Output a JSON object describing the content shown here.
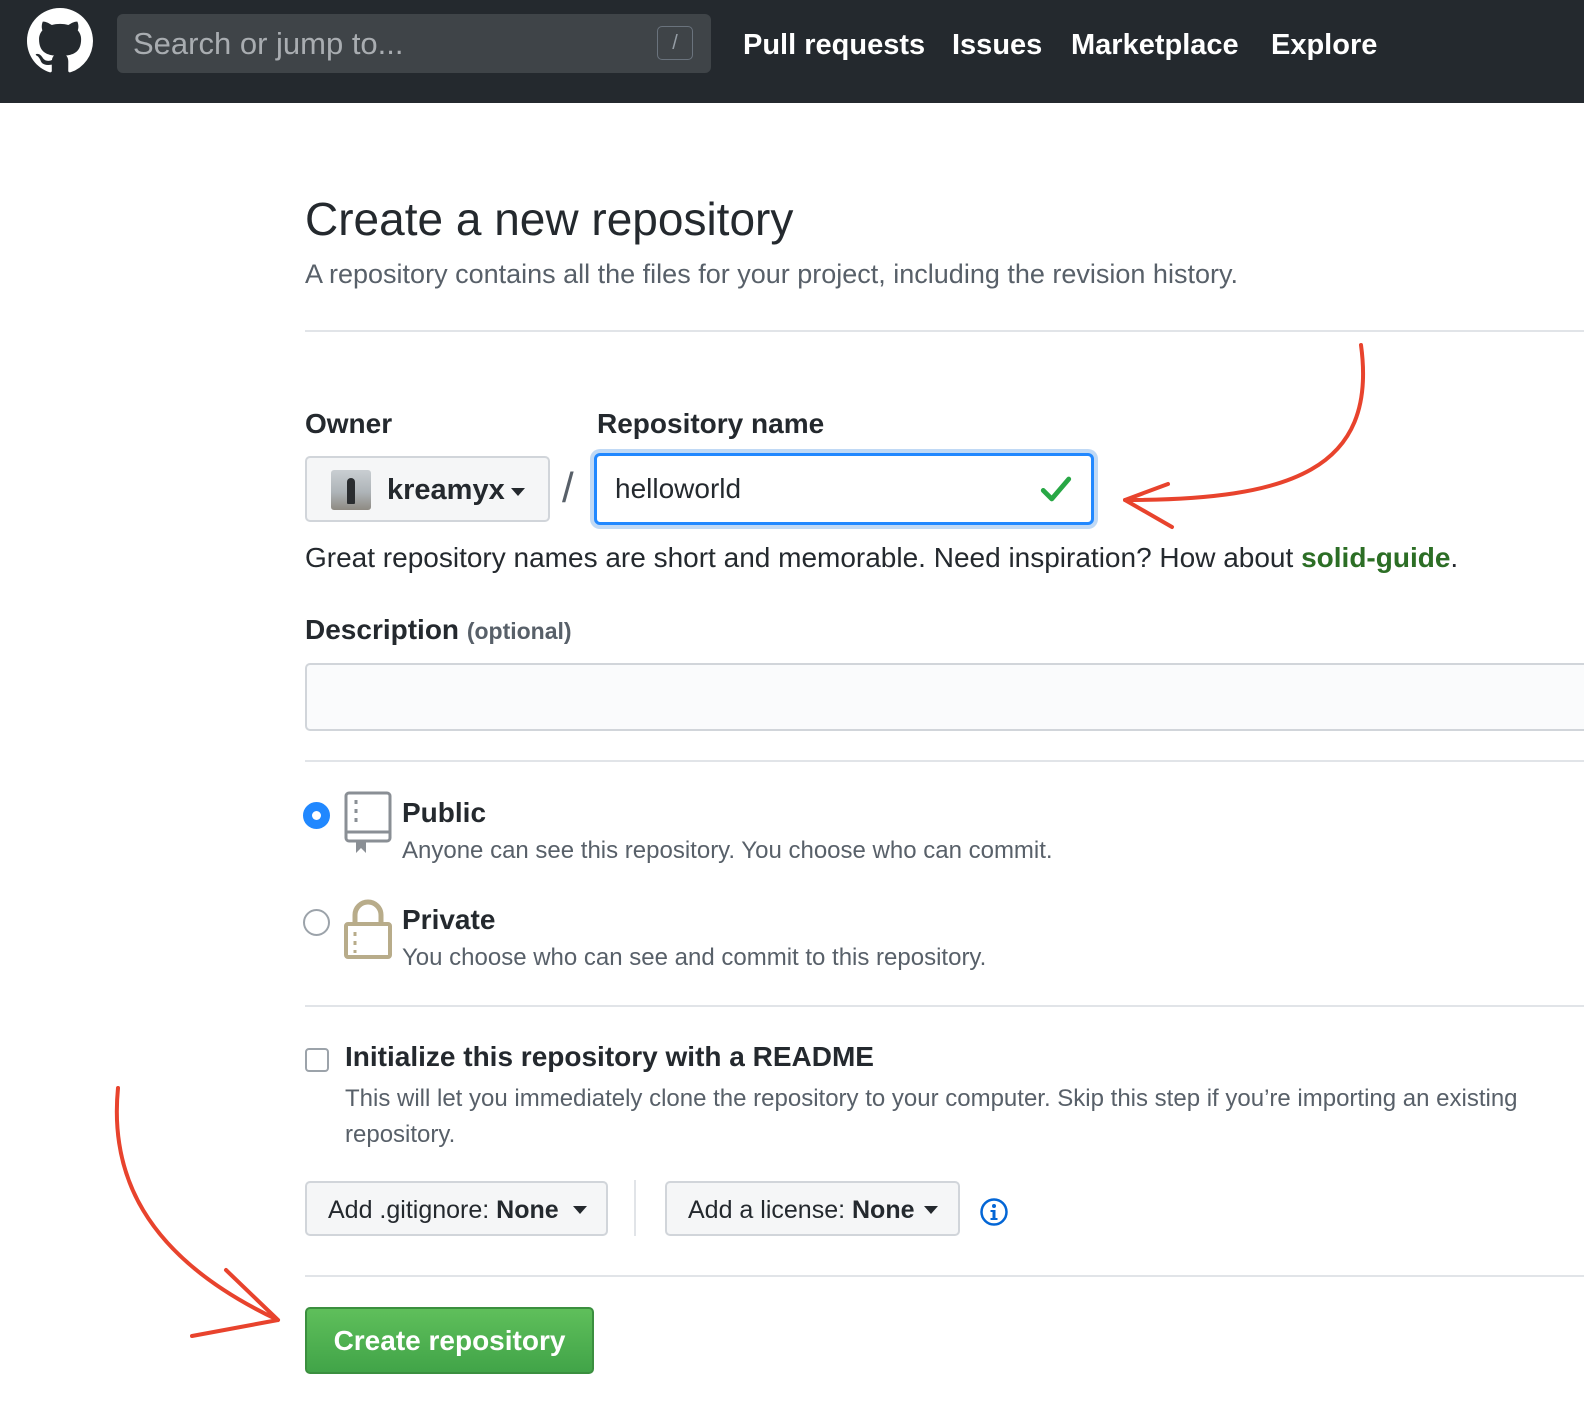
{
  "header": {
    "search_placeholder": "Search or jump to...",
    "search_shortcut": "/",
    "nav": [
      "Pull requests",
      "Issues",
      "Marketplace",
      "Explore"
    ]
  },
  "page": {
    "title": "Create a new repository",
    "subtitle": "A repository contains all the files for your project, including the revision history."
  },
  "form": {
    "owner_label": "Owner",
    "owner_value": "kreamyx",
    "repo_label": "Repository name",
    "repo_separator": "/",
    "repo_value": "helloworld",
    "hint_text": "Great repository names are short and memorable. Need inspiration? How about ",
    "hint_suggestion": "solid-guide",
    "hint_suffix": ".",
    "description_label": "Description",
    "description_optional": "(optional)",
    "description_value": ""
  },
  "visibility": {
    "public": {
      "title": "Public",
      "desc": "Anyone can see this repository. You choose who can commit.",
      "selected": true
    },
    "private": {
      "title": "Private",
      "desc": "You choose who can see and commit to this repository.",
      "selected": false
    }
  },
  "readme": {
    "title": "Initialize this repository with a README",
    "desc_line1": "This will let you immediately clone the repository to your computer. Skip this step if you’re importing an existing",
    "desc_line2": "repository.",
    "checked": false
  },
  "extras": {
    "gitignore_label": "Add .gitignore:",
    "gitignore_value": "None",
    "license_label": "Add a license:",
    "license_value": "None"
  },
  "submit_label": "Create repository",
  "colors": {
    "header_bg": "#24292e",
    "primary_green": "#41a448",
    "focus_blue": "#2188ff",
    "annotation_red": "#e8432d"
  }
}
